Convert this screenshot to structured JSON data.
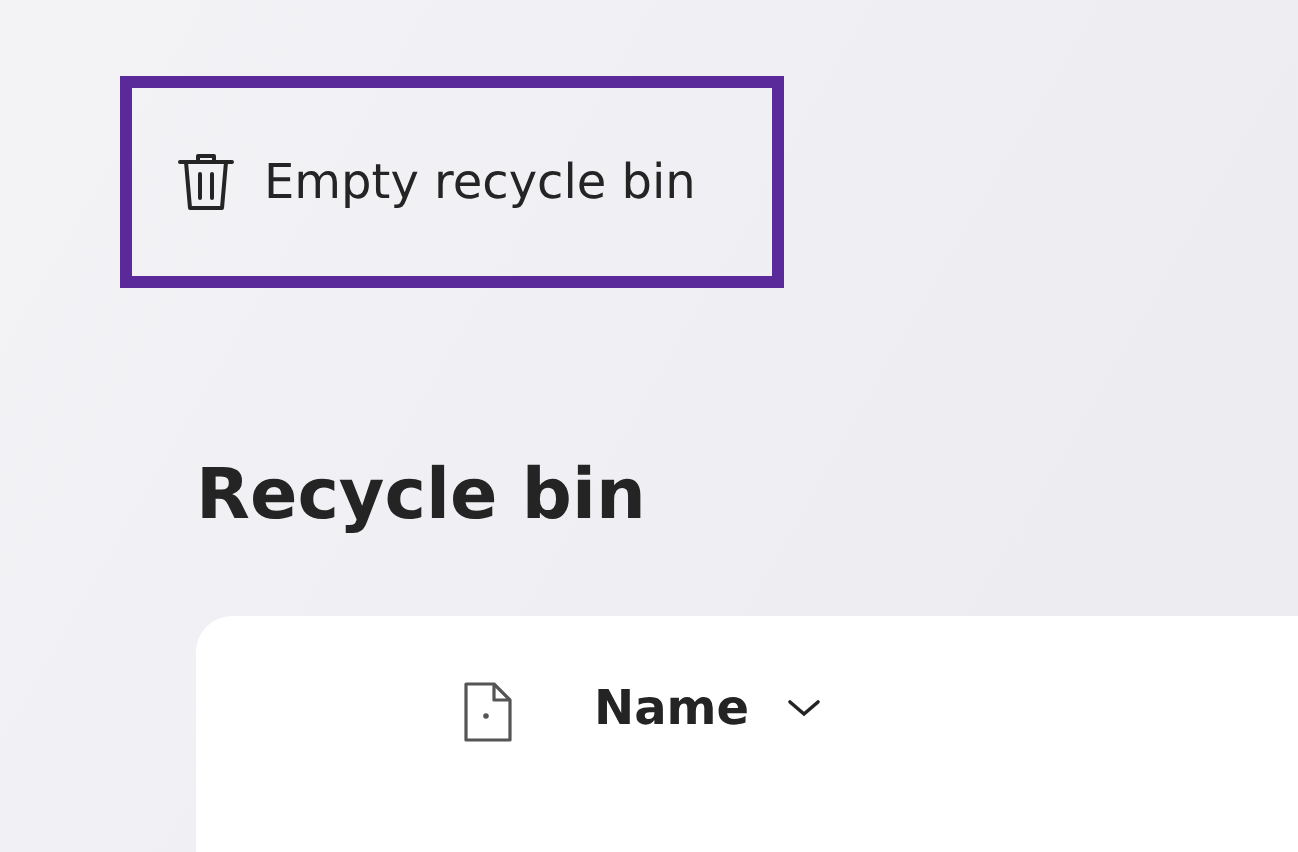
{
  "toolbar": {
    "empty_button": {
      "label": "Empty recycle bin",
      "focused": true
    }
  },
  "heading": "Recycle bin",
  "table": {
    "columns": [
      {
        "label": "Name",
        "sorted": true
      }
    ]
  }
}
